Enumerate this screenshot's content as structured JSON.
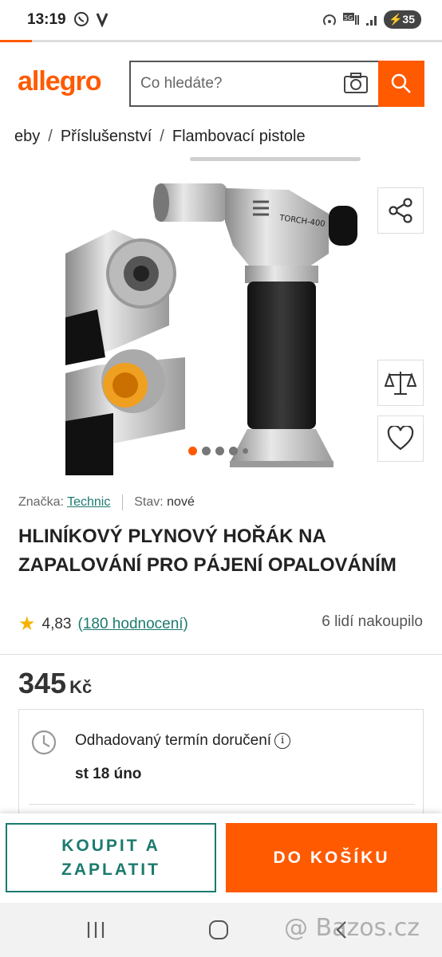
{
  "status_bar": {
    "time": "13:19",
    "battery": "35"
  },
  "header": {
    "logo": "allegro",
    "search_placeholder": "Co hledáte?"
  },
  "breadcrumb": [
    "eby",
    "Příslušenství",
    "Flambovací pistole"
  ],
  "product": {
    "brand_label": "Značka:",
    "brand": "Technic",
    "condition_label": "Stav:",
    "condition": "nové",
    "title": "HLINÍKOVÝ PLYNOVÝ HOŘÁK NA ZAPALOVÁNÍ PRO PÁJENÍ OPALOVÁNÍM",
    "rating": "4,83",
    "reviews": "(180 hodnocení)",
    "bought": "6 lidí nakoupilo",
    "price": "345",
    "currency": "Kč",
    "torch_label": "TORCH-400",
    "gallery_slides": 5,
    "gallery_active_slide": 1
  },
  "delivery": {
    "label": "Odhadovaný termín doručení",
    "date": "st 18 úno"
  },
  "actions": {
    "buy_line1": "KOUPIT A",
    "buy_line2": "ZAPLATIT",
    "cart": "DO KOŠÍKU"
  },
  "watermark": "@ Bazos.cz",
  "colors": {
    "brand": "#ff5a00",
    "link": "#1c7a6e",
    "star": "#f5b301"
  }
}
